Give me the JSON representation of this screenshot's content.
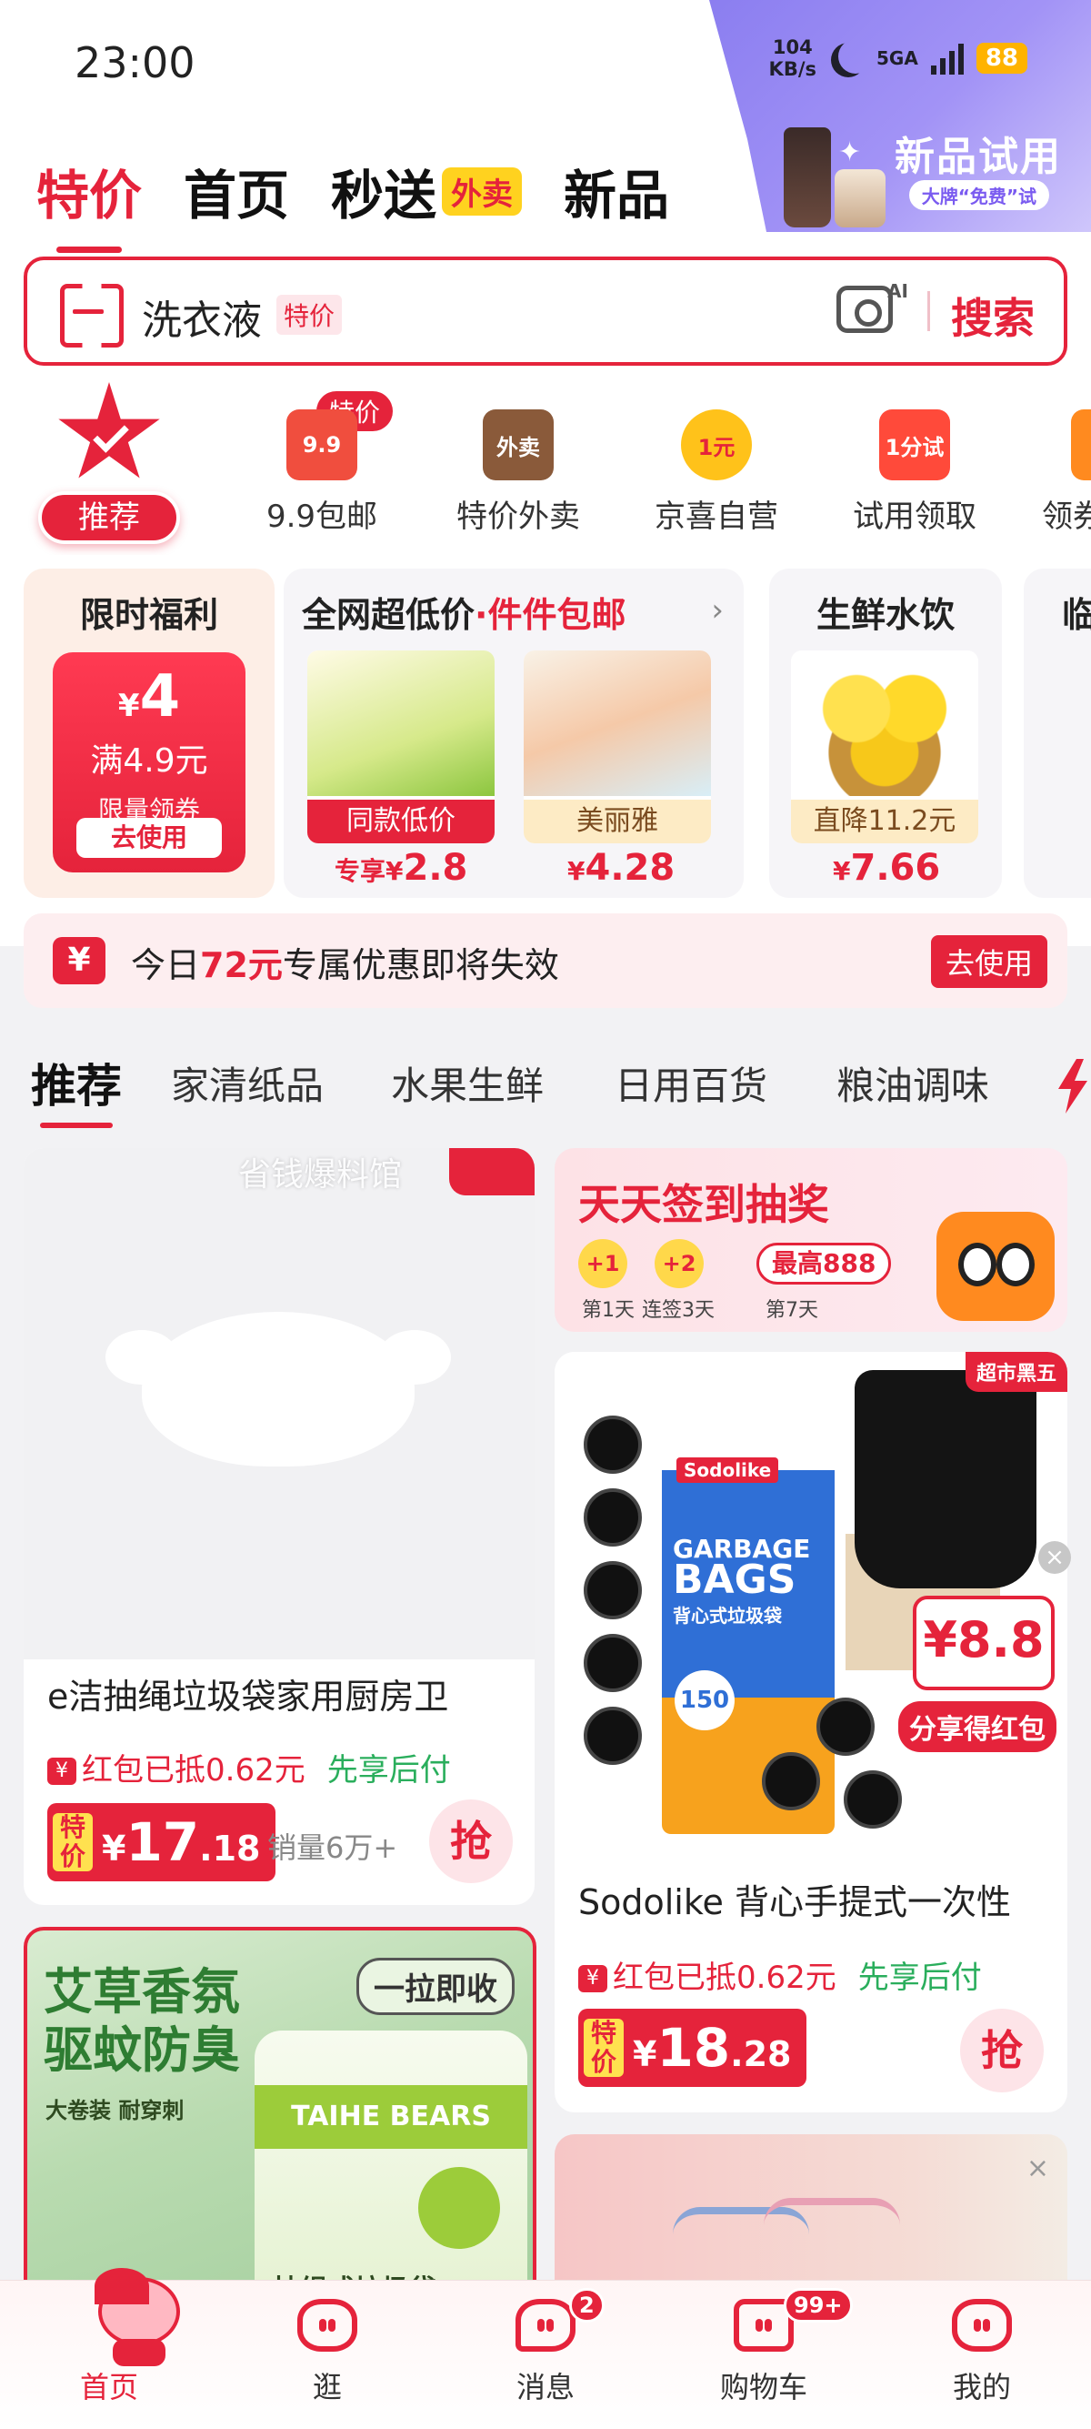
{
  "status_bar": {
    "time": "23:00",
    "net_speed": "104",
    "net_unit": "KB/s",
    "signal": "5GA",
    "battery": "88"
  },
  "top_nav": {
    "tabs": [
      "特价",
      "首页",
      "秒送",
      "新品"
    ],
    "waimai_badge": "外卖",
    "active_index": 0
  },
  "promo_corner": {
    "title": "新品试用",
    "subtitle": "大牌“免费”试"
  },
  "search": {
    "query": "洗衣液",
    "tag": "特价",
    "ai_label": "AI",
    "button": "搜索"
  },
  "icon_row": {
    "recommend_label": "推荐",
    "badge": "特价",
    "items": [
      {
        "label": "9.9包邮",
        "icon": "nine-nine-icon",
        "icon_text": "9.9",
        "color": "#f04e3e"
      },
      {
        "label": "特价外卖",
        "icon": "takeaway-bag-icon",
        "icon_text": "外卖",
        "color": "#8a5a3a"
      },
      {
        "label": "京喜自营",
        "icon": "one-yuan-icon",
        "icon_text": "1元",
        "color": "#ffc21a"
      },
      {
        "label": "试用领取",
        "icon": "trial-bag-icon",
        "icon_text": "1分试",
        "color": "#ff4a3a"
      },
      {
        "label": "领券",
        "icon": "coupon-icon",
        "icon_text": "",
        "color": "#ff8a1f"
      }
    ]
  },
  "promo_cards": {
    "limited": {
      "title": "限时福利",
      "yen": "¥",
      "amount": "4",
      "condition": "满4.9元",
      "note": "限量领券",
      "button": "去使用"
    },
    "lowprice": {
      "title": "全网超低价",
      "dot": "·",
      "highlight": "件件包邮",
      "products": [
        {
          "tag": "同款低价",
          "price_prefix": "专享",
          "yen": "¥",
          "price": "2.8"
        },
        {
          "tag": "美丽雅",
          "price_prefix": "",
          "yen": "¥",
          "price": "4.28"
        }
      ]
    },
    "fresh": {
      "title": "生鲜水饮",
      "tag": "直降11.2元",
      "yen": "¥",
      "price": "7.66"
    },
    "partial_title": "临"
  },
  "notice": {
    "icon": "¥",
    "prefix": "今日",
    "amount": "72元",
    "suffix": "专属优惠即将失效",
    "button": "去使用"
  },
  "category_tabs": {
    "items": [
      "推荐",
      "家清纸品",
      "水果生鲜",
      "日用百货",
      "粮油调味"
    ],
    "active_index": 0
  },
  "feed": {
    "item1": {
      "watermark": "省钱爆料馆",
      "title": "e洁抽绳垃圾袋家用厨房卫",
      "red_packet": "红包已抵0.62元",
      "pay_later": "先享后付",
      "price_label": "特价",
      "yen": "¥",
      "price_int": "17",
      "price_dec": ".18",
      "sold": "销量6万+",
      "grab": "抢"
    },
    "checkin": {
      "title": "天天签到抽奖",
      "dot1": "+1",
      "dot2": "+2",
      "max": "最高888",
      "day1": "第1天",
      "day3": "连签3天",
      "day7": "第7天"
    },
    "item2": {
      "hot_tag": "超市黑五",
      "brand": "Sodolike",
      "bag_text1": "GARBAGE",
      "bag_text2": "BAGS",
      "bag_sub": "背心式垃圾袋",
      "bag_count": "150",
      "share_price": "¥8.8",
      "share_label": "分享得红包",
      "title": "Sodolike 背心手提式一次性",
      "red_packet": "红包已抵0.62元",
      "pay_later": "先享后付",
      "price_label": "特价",
      "yen": "¥",
      "price_int": "18",
      "price_dec": ".28",
      "grab": "抢",
      "close": "×"
    },
    "item3": {
      "headline_line1": "艾草香氛",
      "headline_line2": "驱蚊防臭",
      "sub": "大卷装 耐穿刺",
      "pull": "一拉即收",
      "brand": "TAIHE BEARS",
      "desc": "抽绳式垃圾袋"
    }
  },
  "bottom_nav": {
    "items": [
      {
        "label": "首页",
        "badge": ""
      },
      {
        "label": "逛",
        "badge": ""
      },
      {
        "label": "消息",
        "badge": "2"
      },
      {
        "label": "购物车",
        "badge": "99+"
      },
      {
        "label": "我的",
        "badge": ""
      }
    ],
    "active_index": 0
  },
  "colors": {
    "accent": "#e5233b",
    "green": "#2aae5c",
    "promo_purple": "#8b7ef0"
  }
}
